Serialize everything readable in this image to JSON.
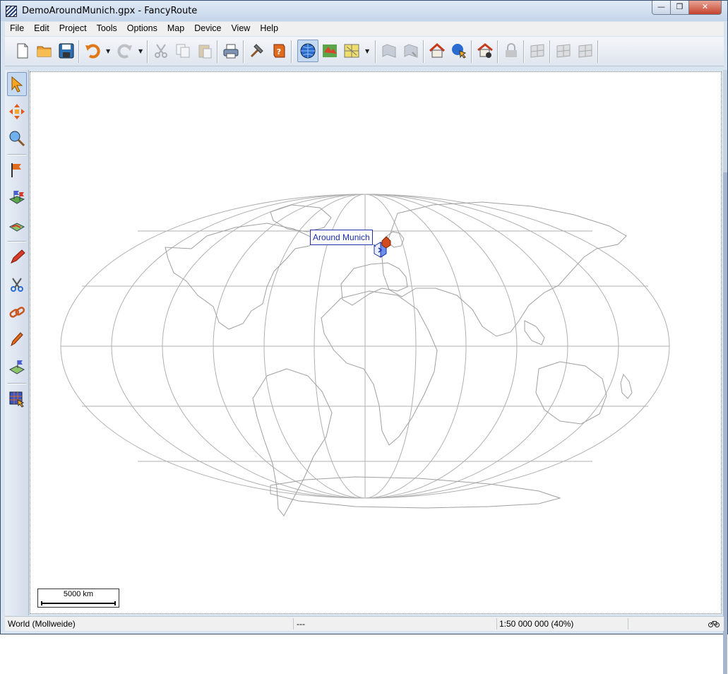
{
  "window": {
    "title": "DemoAroundMunich.gpx - FancyRoute",
    "controls": {
      "minimize": "—",
      "maximize": "❐",
      "close": "✕"
    }
  },
  "menu": [
    "File",
    "Edit",
    "Project",
    "Tools",
    "Options",
    "Map",
    "Device",
    "View",
    "Help"
  ],
  "toolbar": {
    "buttons": [
      "new-document",
      "open-folder",
      "save",
      "undo",
      "redo",
      "cut",
      "copy",
      "paste",
      "print",
      "build-hammer",
      "help-book",
      "world-map",
      "topo-map",
      "street-map",
      "layers-a",
      "layers-b",
      "home",
      "globe-pointer",
      "home-gps",
      "lock",
      "tiles",
      "tiles-a",
      "tiles-b"
    ],
    "active": "world-map"
  },
  "left_tools": {
    "buttons": [
      "select-arrow",
      "pan-cross",
      "zoom-magnifier",
      "waypoint-flag",
      "route-flags",
      "route-map",
      "pencil-draw",
      "scissors",
      "chain-link",
      "pencil-edit",
      "flag-map",
      "grid-select"
    ],
    "active": "select-arrow"
  },
  "map": {
    "projection_note": "World (Mollweide)",
    "waypoint_label": "Around Munich",
    "scale_label": "5000 km",
    "colors": {
      "graticule": "#b0b0b0",
      "coast": "#a0a0a0",
      "label": "#1c2ea8",
      "marker": "#d24a1e"
    }
  },
  "status": {
    "projection": "World (Mollweide)",
    "coords": "---",
    "scale": "1:50 000 000 (40%)",
    "icon": "bicycle-icon"
  }
}
